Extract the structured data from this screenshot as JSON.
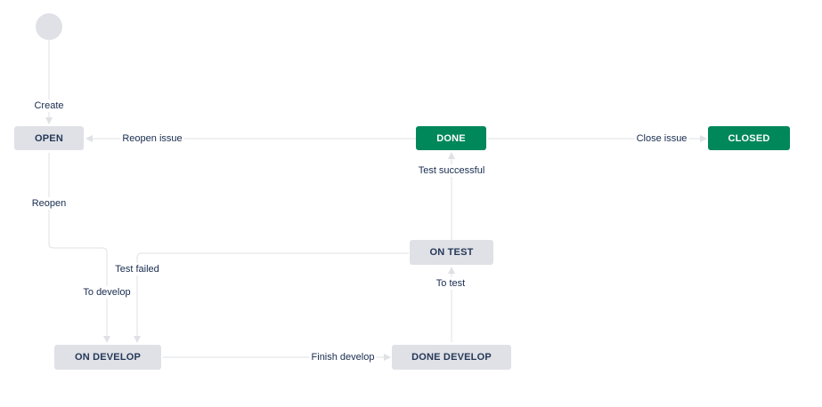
{
  "statuses": {
    "open": "OPEN",
    "done": "DONE",
    "closed": "CLOSED",
    "on_test": "ON TEST",
    "on_develop": "ON DEVELOP",
    "done_develop": "DONE DEVELOP"
  },
  "transitions": {
    "create": "Create",
    "reopen_issue": "Reopen issue",
    "close_issue": "Close issue",
    "test_successful": "Test successful",
    "reopen": "Reopen",
    "test_failed": "Test failed",
    "to_develop": "To develop",
    "to_test": "To test",
    "finish_develop": "Finish develop"
  },
  "colors": {
    "status_todo_bg": "#dfe1e6",
    "status_todo_text": "#253858",
    "status_done_bg": "#00875a",
    "status_done_text": "#ffffff",
    "connector": "#dfe1e6",
    "label_text": "#172b4d"
  }
}
